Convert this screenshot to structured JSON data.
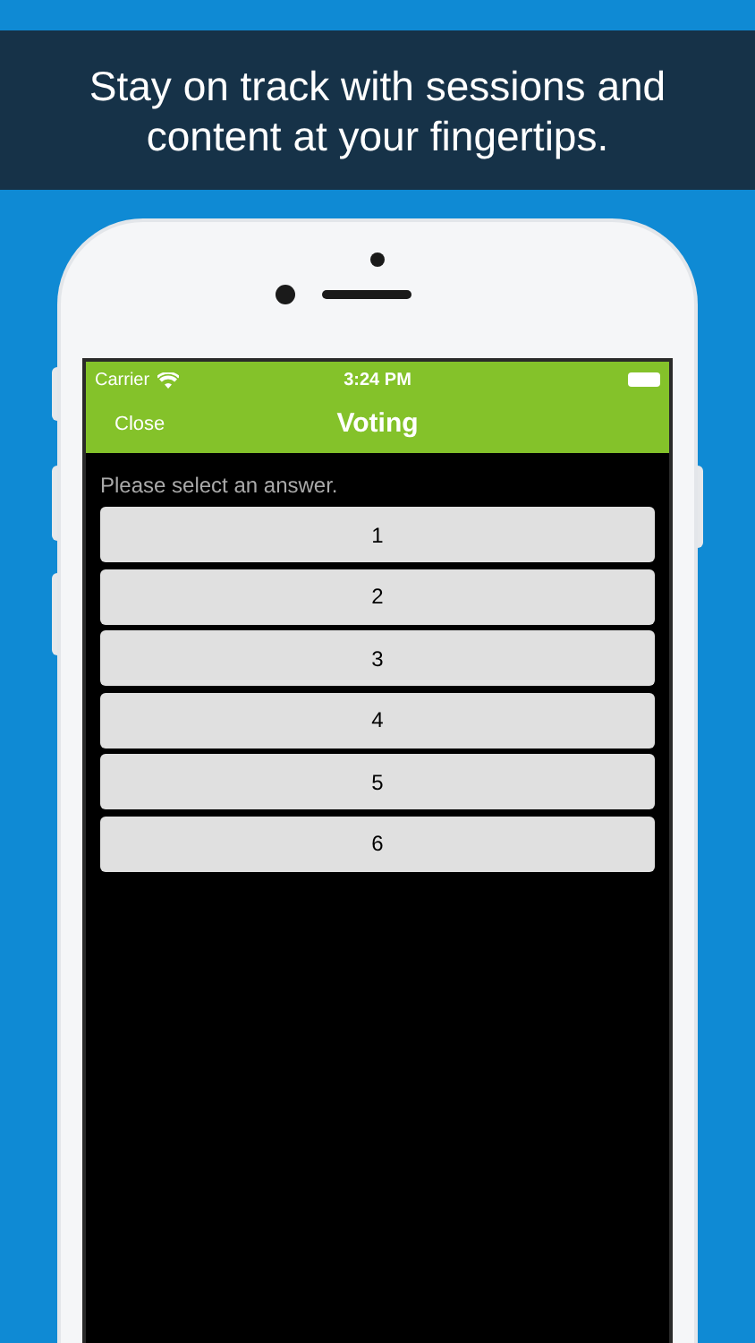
{
  "banner": {
    "headline": "Stay on track with sessions and content at your fingertips."
  },
  "status_bar": {
    "carrier": "Carrier",
    "time": "3:24 PM"
  },
  "nav_bar": {
    "left_button": "Close",
    "title": "Voting"
  },
  "prompt": "Please select an answer.",
  "answers": [
    {
      "label": "1"
    },
    {
      "label": "2"
    },
    {
      "label": "3"
    },
    {
      "label": "4"
    },
    {
      "label": "5"
    },
    {
      "label": "6"
    }
  ]
}
